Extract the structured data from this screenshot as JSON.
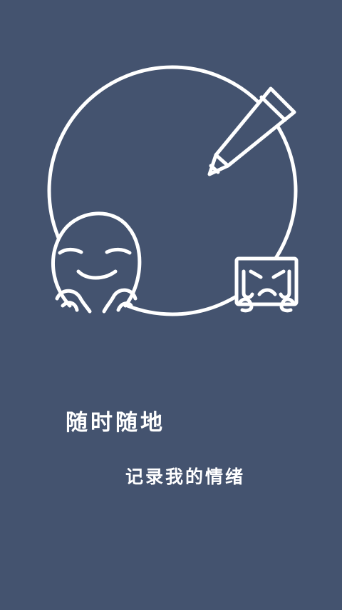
{
  "screen": {
    "background_color": "#44536f",
    "line_color": "#ffffff",
    "icons": [
      "journal-circle-icon",
      "pencil-icon",
      "smiling-face-icon",
      "crying-face-icon"
    ]
  },
  "tagline": {
    "line1": "随时随地",
    "line2": "记录我的情绪"
  }
}
